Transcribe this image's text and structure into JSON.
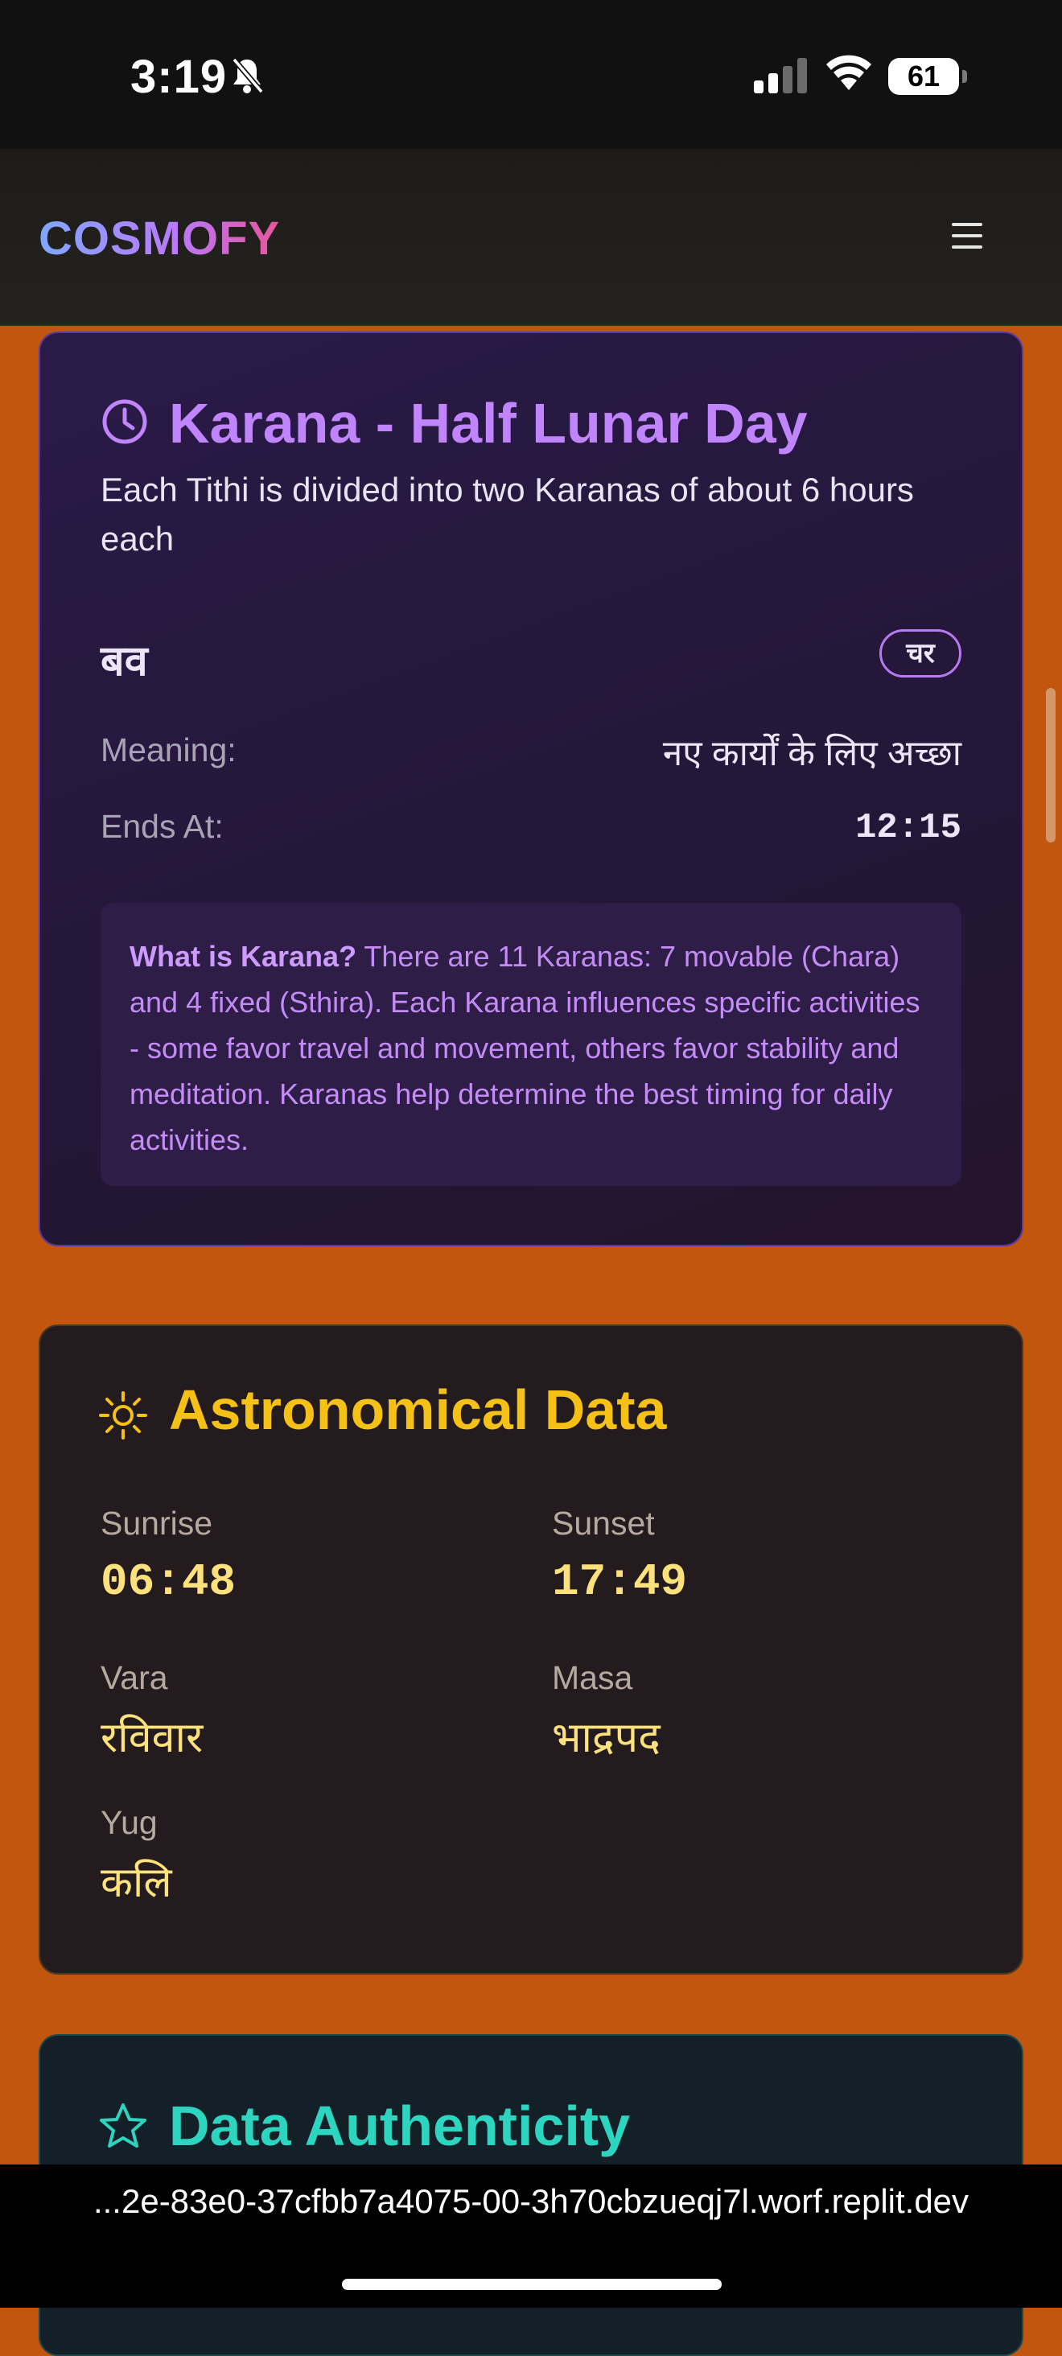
{
  "status_bar": {
    "time": "3:19",
    "battery": "61"
  },
  "header": {
    "logo": "COSMOFY"
  },
  "karana": {
    "title": "Karana - Half Lunar Day",
    "subtitle": "Each Tithi is divided into two Karanas of about 6 hours each",
    "name": "बव",
    "badge": "चर",
    "meaning_label": "Meaning:",
    "meaning_value": "नए कार्यों के लिए अच्छा",
    "ends_label": "Ends At:",
    "ends_value": "12:15",
    "info_heading": "What is Karana?",
    "info_text": "There are 11 Karanas: 7 movable (Chara) and 4 fixed (Sthira). Each Karana influences specific activities - some favor travel and movement, others favor stability and meditation. Karanas help determine the best timing for daily activities."
  },
  "astro": {
    "title": "Astronomical Data",
    "sunrise_label": "Sunrise",
    "sunrise_value": "06:48",
    "sunset_label": "Sunset",
    "sunset_value": "17:49",
    "vara_label": "Vara",
    "vara_value": "रविवार",
    "masa_label": "Masa",
    "masa_value": "भाद्रपद",
    "yug_label": "Yug",
    "yug_value": "कलि"
  },
  "authenticity": {
    "title": "Data Authenticity"
  },
  "browser": {
    "url": "...2e-83e0-37cfbb7a4075-00-3h70cbzueqj7l.worf.replit.dev"
  },
  "colors": {
    "page_bg": "#c2560f",
    "karana_accent": "#c084fc",
    "astro_accent": "#f5c117",
    "auth_accent": "#2dd4bf"
  }
}
